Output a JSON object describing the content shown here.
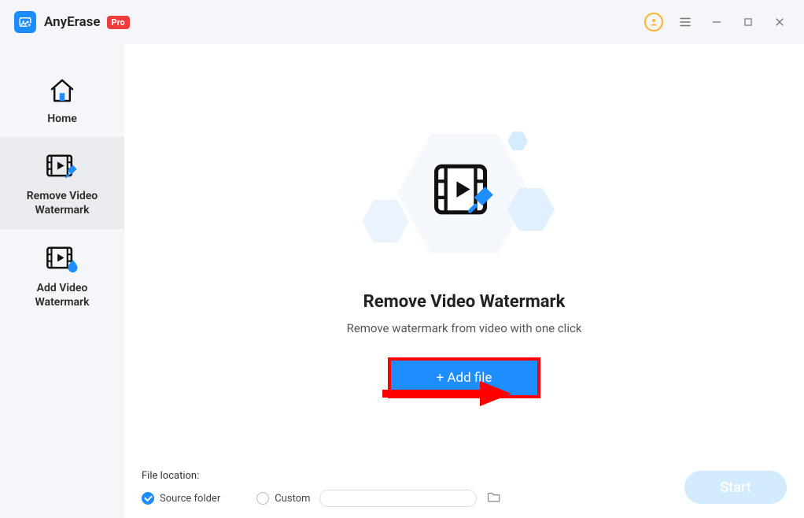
{
  "app": {
    "name": "AnyErase",
    "badge": "Pro"
  },
  "sidebar": {
    "items": [
      {
        "label": "Home"
      },
      {
        "label": "Remove Video\nWatermark"
      },
      {
        "label": "Add Video\nWatermark"
      }
    ]
  },
  "main": {
    "title": "Remove Video Watermark",
    "subtitle": "Remove watermark from video with one click",
    "add_file_label": "+ Add file"
  },
  "file_location": {
    "label": "File location:",
    "source_folder_label": "Source folder",
    "custom_label": "Custom",
    "custom_value": "",
    "selected": "source"
  },
  "actions": {
    "start_label": "Start"
  },
  "colors": {
    "accent": "#1d8dff",
    "badge_red": "#ef3b3b",
    "annotation_red": "#ff0000",
    "avatar_ring": "#fdb22b"
  }
}
